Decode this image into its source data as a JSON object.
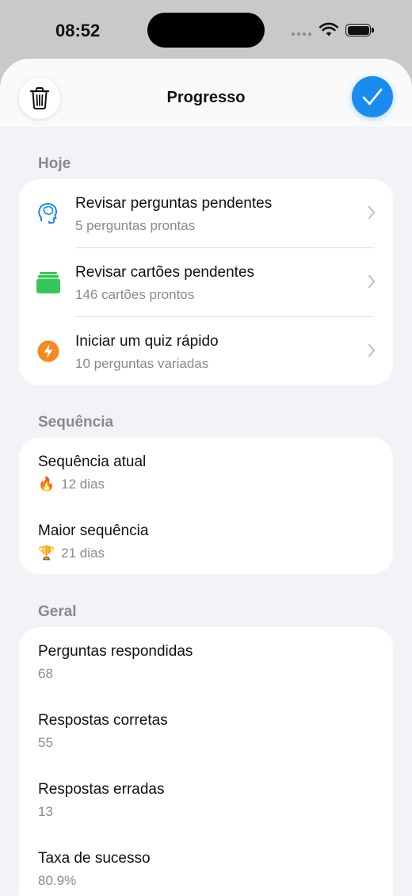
{
  "status_bar": {
    "time": "08:52"
  },
  "header": {
    "title": "Progresso",
    "left_icon": "trash-icon",
    "right_icon": "checkmark-icon",
    "accent": "#1a8cf0"
  },
  "today": {
    "label": "Hoje",
    "items": [
      {
        "title": "Revisar perguntas pendentes",
        "subtitle": "5 perguntas prontas",
        "icon": "brain-head-icon",
        "color": "#1a8cf0"
      },
      {
        "title": "Revisar cartões pendentes",
        "subtitle": "146 cartões prontos",
        "icon": "cards-stack-icon",
        "color": "#34c759"
      },
      {
        "title": "Iniciar um quiz rápido",
        "subtitle": "10 perguntas variadas",
        "icon": "bolt-icon",
        "color": "#f58a1f"
      }
    ]
  },
  "streak": {
    "label": "Sequência",
    "items": [
      {
        "title": "Sequência atual",
        "emoji": "🔥",
        "value": "12 dias"
      },
      {
        "title": "Maior sequência",
        "emoji": "🏆",
        "value": "21 dias"
      }
    ]
  },
  "general": {
    "label": "Geral",
    "items": [
      {
        "title": "Perguntas respondidas",
        "value": "68"
      },
      {
        "title": "Respostas corretas",
        "value": "55"
      },
      {
        "title": "Respostas erradas",
        "value": "13"
      },
      {
        "title": "Taxa de sucesso",
        "value": "80.9%"
      }
    ]
  }
}
